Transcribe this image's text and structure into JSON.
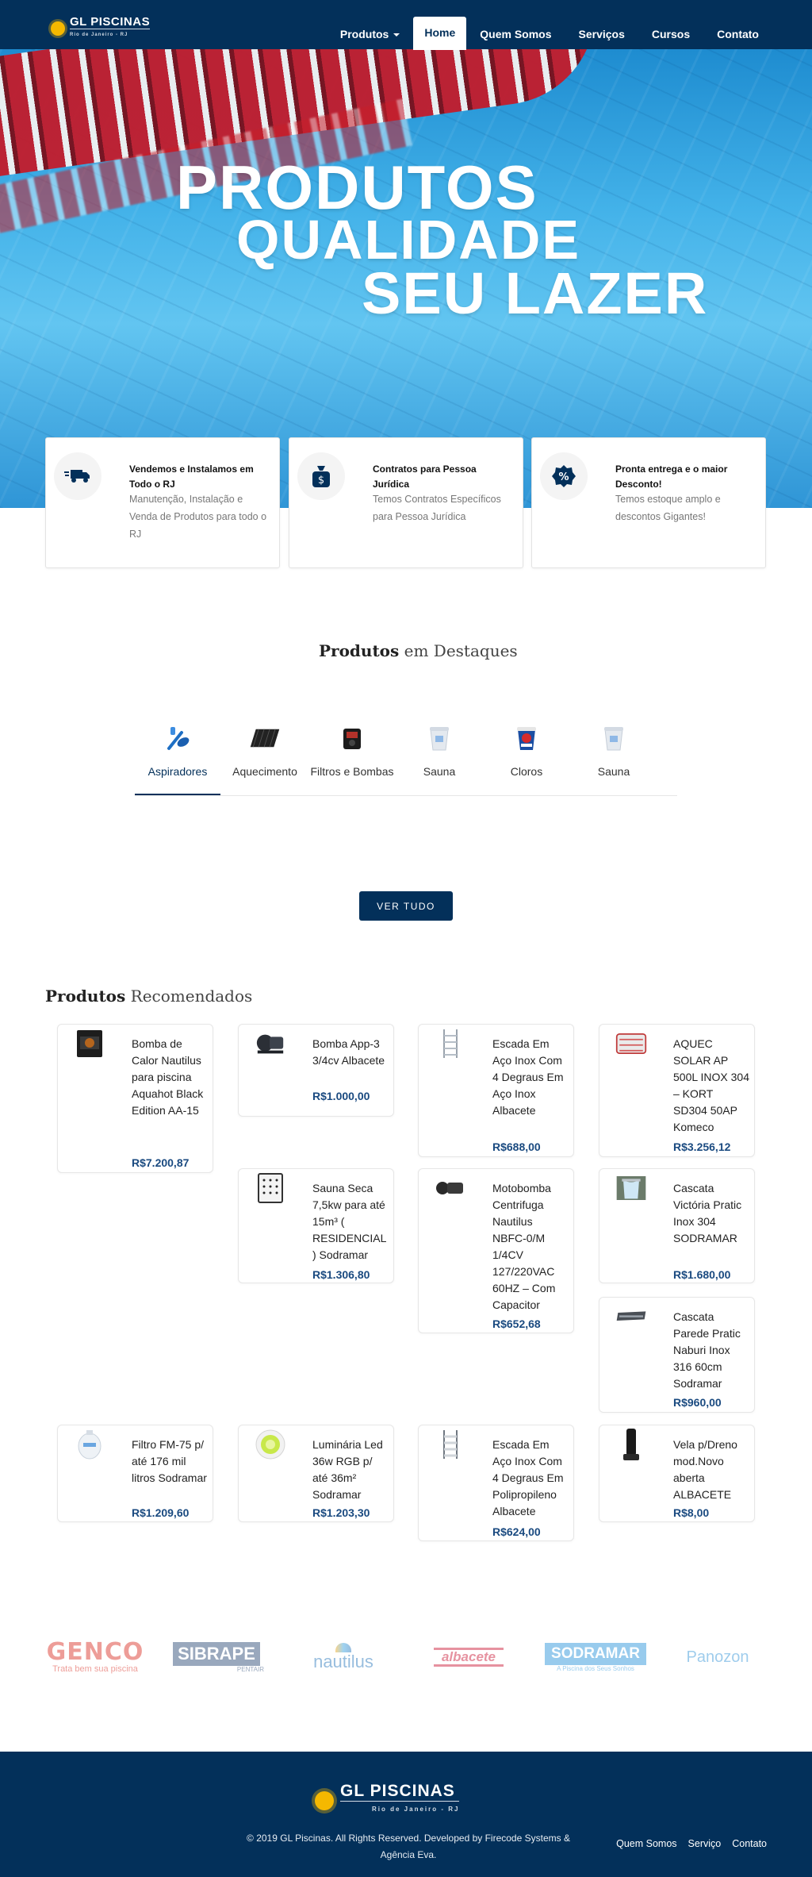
{
  "nav": {
    "logo": {
      "name": "GL PISCINAS",
      "tagline": "Rio de Janeiro - RJ"
    },
    "items": [
      {
        "label": "Produtos",
        "dropdown": true
      },
      {
        "label": "Home",
        "active": true
      },
      {
        "label": "Quem Somos"
      },
      {
        "label": "Serviços"
      },
      {
        "label": "Cursos"
      },
      {
        "label": "Contato"
      }
    ]
  },
  "hero": {
    "line1": "PRODUTOS",
    "line2": "QUALIDADE",
    "line3": "SEU LAZER"
  },
  "features": [
    {
      "icon": "truck-icon",
      "title": "Vendemos e Instalamos em Todo o RJ",
      "description": "Manutenção, Instalação e Venda de Produtos para todo o RJ"
    },
    {
      "icon": "money-bag-icon",
      "title": "Contratos para Pessoa Jurídica",
      "description": "Temos Contratos Específicos para Pessoa Jurídica"
    },
    {
      "icon": "percent-badge-icon",
      "title": "Pronta entrega e o maior Desconto!",
      "description": "Temos estoque amplo e descontos Gigantes!"
    }
  ],
  "featured": {
    "title_bold": "Produtos",
    "title_rest": "em Destaques",
    "tabs": [
      {
        "label": "Aspiradores",
        "icon": "vacuum-brush-icon",
        "active": true
      },
      {
        "label": "Aquecimento",
        "icon": "solar-panel-icon"
      },
      {
        "label": "Filtros e Bombas",
        "icon": "pump-icon"
      },
      {
        "label": "Sauna",
        "icon": "bucket-icon"
      },
      {
        "label": "Cloros",
        "icon": "chlorine-bucket-icon"
      },
      {
        "label": "Sauna",
        "icon": "bucket-icon"
      }
    ],
    "button": "VER TUDO"
  },
  "recommended": {
    "title_bold": "Produtos",
    "title_rest": "Recomendados",
    "products": [
      {
        "name": "Bomba de Calor Nautilus para piscina Aquahot Black Edition AA-15",
        "price": "R$7.200,87",
        "icon": "heat-pump-icon"
      },
      {
        "name": "Bomba App-3 3/4cv Albacete",
        "price": "R$1.000,00",
        "icon": "pool-pump-icon"
      },
      {
        "name": "Escada Em Aço Inox Com 4 Degraus Em Aço Inox Albacete",
        "price": "R$688,00",
        "icon": "pool-ladder-icon"
      },
      {
        "name": "AQUEC SOLAR AP 500L INOX 304 – KORT SD304 50AP Komeco",
        "price": "R$3.256,12",
        "icon": "solar-heater-icon"
      },
      {
        "name": "Sauna Seca 7,5kw para até 15m³ ( RESIDENCIAL ) Sodramar",
        "price": "R$1.306,80",
        "icon": "sauna-heater-icon"
      },
      {
        "name": "Motobomba Centrifuga Nautilus NBFC-0/M 1/4CV 127/220VAC 60HZ – Com Capacitor",
        "price": "R$652,68",
        "icon": "motor-pump-icon"
      },
      {
        "name": "Cascata Victória Pratic Inox 304 SODRAMAR",
        "price": "R$1.680,00",
        "icon": "waterfall-icon"
      },
      {
        "name": "Cascata Parede Pratic Naburi Inox 316 60cm Sodramar",
        "price": "R$960,00",
        "icon": "wall-cascade-icon"
      },
      {
        "name": "Filtro FM-75 p/ até 176 mil litros Sodramar",
        "price": "R$1.209,60",
        "icon": "filter-tank-icon"
      },
      {
        "name": "Luminária Led 36w RGB p/ até 36m² Sodramar",
        "price": "R$1.203,30",
        "icon": "led-light-icon"
      },
      {
        "name": "Escada Em Aço Inox Com 4 Degraus Em Polipropileno Albacete",
        "price": "R$624,00",
        "icon": "pool-ladder-icon"
      },
      {
        "name": "Vela p/Dreno mod.Novo aberta ALBACETE",
        "price": "R$8,00",
        "icon": "drain-pipe-icon"
      }
    ]
  },
  "brands": [
    {
      "name": "GENCO",
      "tagline": "Trata bem sua piscina",
      "color": "#d9281c"
    },
    {
      "name": "SIBRAPE",
      "tagline": "PENTAIR",
      "color": "#1e3f6e"
    },
    {
      "name": "nautilus",
      "tagline": "",
      "color": "#1b6fb8"
    },
    {
      "name": "albacete",
      "tagline": "",
      "color": "#c8102e"
    },
    {
      "name": "SODRAMAR",
      "tagline": "A Piscina dos Seus Sonhos",
      "color": "#1d8ed8"
    },
    {
      "name": "Panozon",
      "tagline": "",
      "color": "#2b8fd6"
    }
  ],
  "footer": {
    "logo": {
      "name": "GL PISCINAS",
      "tagline": "Rio de Janeiro - RJ"
    },
    "copyright": "© 2019 GL Piscinas. All Rights Reserved. Developed by Firecode Systems & Agência Eva.",
    "links": [
      "Quem Somos",
      "Serviço",
      "Contato"
    ]
  },
  "colors": {
    "primary": "#03305a",
    "price": "#1a4a80",
    "hero_water": "#43b2e9"
  }
}
